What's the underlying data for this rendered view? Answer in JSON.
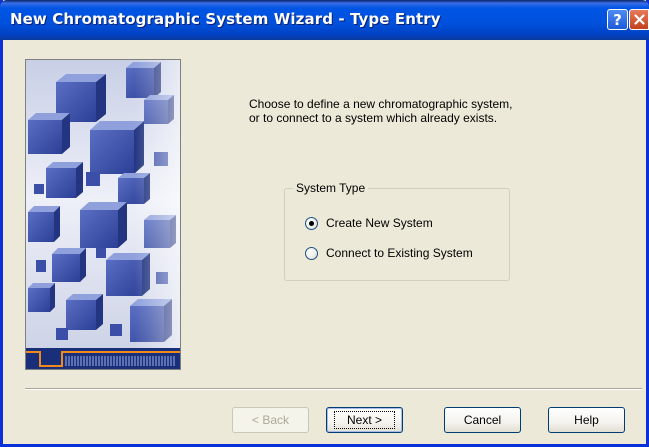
{
  "window": {
    "title": "New Chromatographic System Wizard - Type Entry",
    "help_glyph": "?",
    "colors": {
      "titlebar": "#0055e5",
      "face": "#ece9d8",
      "close": "#c4401d"
    }
  },
  "intro": {
    "line1": "Choose to define a new chromatographic system,",
    "line2": "or to connect to a system which already exists."
  },
  "system_type": {
    "legend": "System Type",
    "options": [
      {
        "label": "Create New System",
        "selected": true
      },
      {
        "label": "Connect to Existing System",
        "selected": false
      }
    ]
  },
  "buttons": {
    "back": "< Back",
    "next": "Next >",
    "cancel": "Cancel",
    "help": "Help"
  }
}
